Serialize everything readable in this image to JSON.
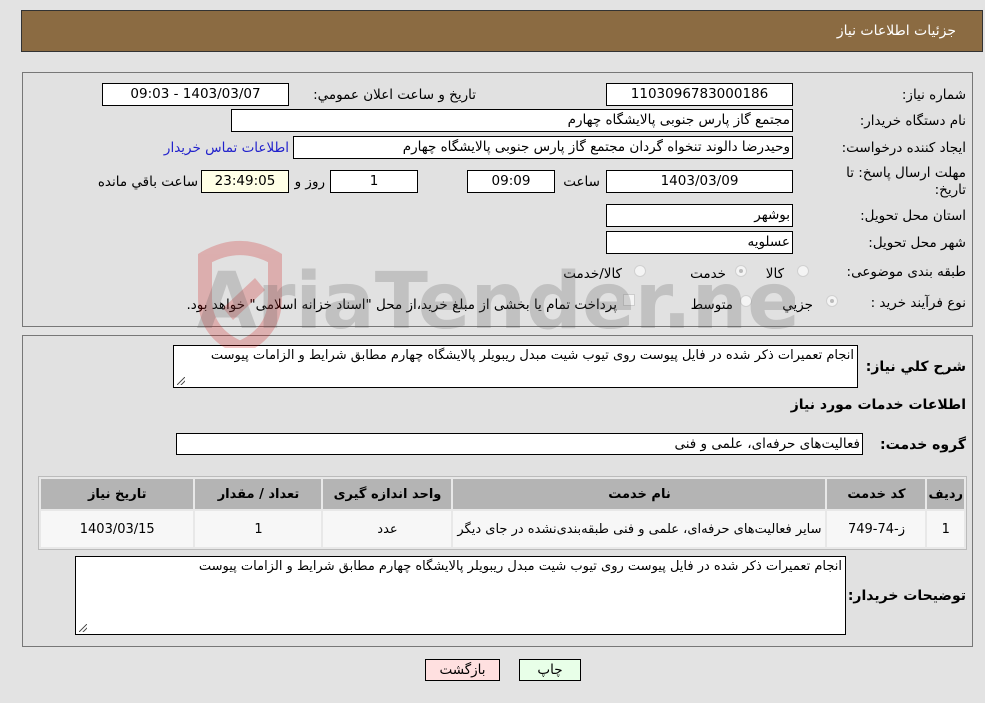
{
  "header": {
    "title": "جزئیات اطلاعات نیاز"
  },
  "fields": {
    "need_number_label": "شماره نیاز:",
    "need_number": "1103096783000186",
    "announce_label": "تاریخ و ساعت اعلان عمومي:",
    "announce_value": "1403/03/07 - 09:03",
    "buyer_org_label": "نام دستگاه خریدار:",
    "buyer_org": "مجتمع گاز پارس جنوبی  پالایشگاه چهارم",
    "creator_label": "ایجاد کننده درخواست:",
    "creator": "وحیدرضا دالوند تنخواه گردان مجتمع گاز پارس جنوبی  پالایشگاه چهارم",
    "contact_link": "اطلاعات تماس خریدار",
    "deadline_label": "مهلت ارسال پاسخ: تا تاریخ:",
    "deadline_date": "1403/03/09",
    "time_label": "ساعت",
    "deadline_time": "09:09",
    "days_value": "1",
    "days_label": "روز و",
    "remaining_time": "23:49:05",
    "remaining_label": "ساعت باقي مانده",
    "province_label": "استان محل تحویل:",
    "province": "بوشهر",
    "city_label": "شهر محل تحویل:",
    "city": "عسلویه",
    "category_label": "طبقه بندی موضوعی:",
    "category_options": [
      "کالا",
      "خدمت",
      "کالا/خدمت"
    ],
    "category_selected": "خدمت",
    "process_label": "نوع فرآیند خرید :",
    "process_options": [
      "جزيي",
      "متوسط"
    ],
    "process_selected": "جزيي",
    "payment_note": "پرداخت تمام یا بخشی از مبلغ خرید،از محل \"اسناد خزانه اسلامی\" خواهد بود."
  },
  "details": {
    "summary_label": "شرح کلي نياز:",
    "summary": "انجام تعمیرات ذکر شده در فایل پیوست روی تیوب شیت مبدل ریبویلر پالایشگاه چهارم مطابق شرایط و الزامات پیوست",
    "services_heading": "اطلاعات خدمات مورد نیاز",
    "service_group_label": "گروه خدمت:",
    "service_group": "فعالیت‌های حرفه‌ای، علمی و فنی",
    "table": {
      "headers": [
        "ردیف",
        "کد خدمت",
        "نام خدمت",
        "واحد اندازه گیری",
        "تعداد / مقدار",
        "تاریخ نیاز"
      ],
      "rows": [
        [
          "1",
          "ز-74-749",
          "سایر فعالیت‌های حرفه‌ای، علمی و فنی طبقه‌بندی‌نشده در جای دیگر",
          "عدد",
          "1",
          "1403/03/15"
        ]
      ]
    },
    "buyer_notes_label": "توضیحات خریدار:",
    "buyer_notes": "انجام تعمیرات ذکر شده در فایل پیوست روی تیوب شیت مبدل ریبویلر پالایشگاه چهارم مطابق شرایط و الزامات پیوست"
  },
  "buttons": {
    "print": "چاپ",
    "back": "بازگشت"
  },
  "watermark": {
    "text": "AriaTender.neT"
  }
}
